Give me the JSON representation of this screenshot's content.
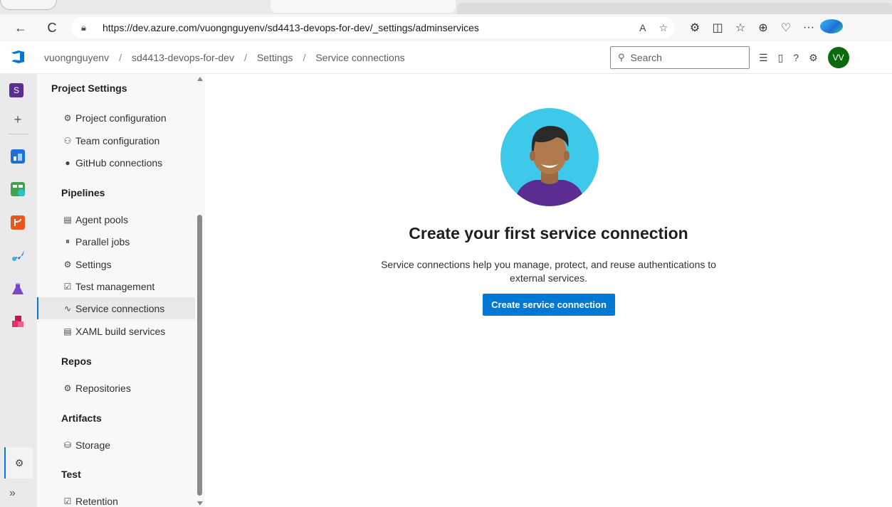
{
  "browser": {
    "url": "https://dev.azure.com/vuongnguyenv/sd4413-devops-for-dev/_settings/adminservices",
    "back_icon": "←",
    "refresh_icon": "C",
    "read_aloud_icon": "A",
    "favorite_icon": "☆",
    "extensions_icon": "⚙",
    "split_icon": "◫",
    "favorites_icon": "☆",
    "collections_icon": "⊕",
    "performance_icon": "♡",
    "more_icon": "···"
  },
  "header": {
    "breadcrumb": [
      "vuongnguyenv",
      "sd4413-devops-for-dev",
      "Settings",
      "Service connections"
    ],
    "separator": "/",
    "search_placeholder": "Search",
    "search_icon": "⚲",
    "avatar_initials": "VV"
  },
  "rail": {
    "org_initial": "S",
    "plus": "+",
    "settings_icon": "⚙",
    "expand_icon": "»"
  },
  "settings_nav": {
    "title": "Project Settings",
    "items_top": [
      {
        "icon": "⚙",
        "label": "Project configuration"
      },
      {
        "icon": "⚇",
        "label": "Team configuration"
      },
      {
        "icon": "●",
        "label": "GitHub connections"
      }
    ],
    "pipelines_label": "Pipelines",
    "pipelines_items": [
      {
        "icon": "▤",
        "label": "Agent pools"
      },
      {
        "icon": "⏸",
        "label": "Parallel jobs"
      },
      {
        "icon": "⚙",
        "label": "Settings"
      },
      {
        "icon": "☑",
        "label": "Test management"
      },
      {
        "icon": "∿",
        "label": "Service connections"
      },
      {
        "icon": "▤",
        "label": "XAML build services"
      }
    ],
    "repos_label": "Repos",
    "repos_items": [
      {
        "icon": "⚙",
        "label": "Repositories"
      }
    ],
    "artifacts_label": "Artifacts",
    "artifacts_items": [
      {
        "icon": "⛁",
        "label": "Storage"
      }
    ],
    "test_label": "Test",
    "test_items": [
      {
        "icon": "☑",
        "label": "Retention"
      }
    ]
  },
  "main": {
    "title": "Create your first service connection",
    "description": "Service connections help you manage, protect, and reuse authentications to external services.",
    "button_label": "Create service connection"
  },
  "colors": {
    "accent": "#0078d4",
    "avatar_bg": "#0b6a0b",
    "org_badge": "#5c2d91"
  }
}
